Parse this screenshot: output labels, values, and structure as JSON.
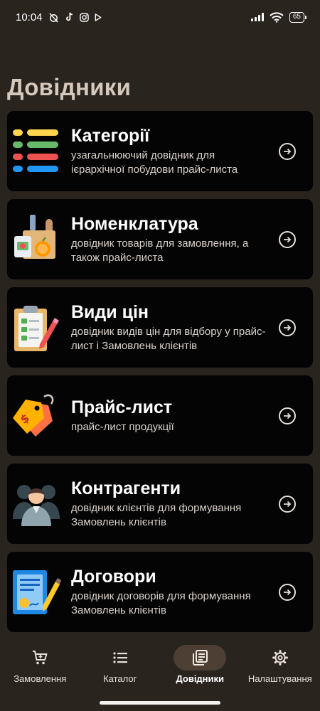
{
  "status_bar": {
    "time": "10:04",
    "battery": "65"
  },
  "page_title": "Довідники",
  "cards": [
    {
      "title": "Категорії",
      "subtitle": "узагальнюючий довідник для ієрархічної побудови прайс-листа",
      "icon": "list-icon"
    },
    {
      "title": "Номенклатура",
      "subtitle": "довідник товарів для замовлення, а також прайс-листа",
      "icon": "grocery-icon"
    },
    {
      "title": "Види цін",
      "subtitle": "довідник видів цін для відбору у прайс-лист і Замовлень клієнтів",
      "icon": "clipboard-icon"
    },
    {
      "title": "Прайс-лист",
      "subtitle": "прайс-лист продукції",
      "icon": "price-tag-icon"
    },
    {
      "title": "Контрагенти",
      "subtitle": "довідник клієнтів для формування Замовлень клієнтів",
      "icon": "people-icon"
    },
    {
      "title": "Договори",
      "subtitle": "довідник договорів для формування Замовлень клієнтів",
      "icon": "contract-icon"
    }
  ],
  "bottom_nav": [
    {
      "label": "Замовлення",
      "icon": "cart-icon",
      "active": false
    },
    {
      "label": "Каталог",
      "icon": "list-lines-icon",
      "active": false
    },
    {
      "label": "Довідники",
      "icon": "book-icon",
      "active": true
    },
    {
      "label": "Налаштування",
      "icon": "gear-icon",
      "active": false
    }
  ],
  "colors": {
    "background": "#2a241f",
    "card": "#050404",
    "title": "#d6c8bb",
    "active_pill": "#4d3f33"
  }
}
